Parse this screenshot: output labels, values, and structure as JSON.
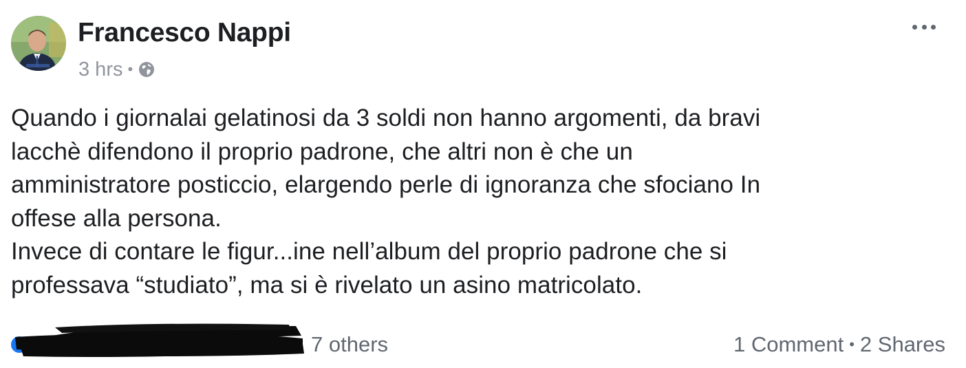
{
  "post": {
    "author": "Francesco Nappi",
    "time": "3 hrs",
    "separator": "•",
    "privacy_icon": "globe-icon",
    "more_icon": "more-options-icon",
    "text": "Quando i giornalai gelatinosi da 3 soldi non hanno argomenti, da bravi\nlacchè difendono il proprio padrone, che altri non è  che un\namministratore posticcio, elargendo perle di ignoranza che sfociano   In\noffese alla persona.\nInvece di contare le figur...ine nell’album del proprio padrone che si\nprofessava “studiato”, ma si è rivelato un asino matricolato."
  },
  "footer": {
    "reactions_icon": "like-icon",
    "reactions_suffix": "7 others",
    "comments": "1 Comment",
    "separator": "•",
    "shares": "2 Shares"
  },
  "colors": {
    "text": "#1c1e21",
    "meta": "#90949c",
    "secondary": "#606770",
    "like_blue": "#1877f2"
  }
}
